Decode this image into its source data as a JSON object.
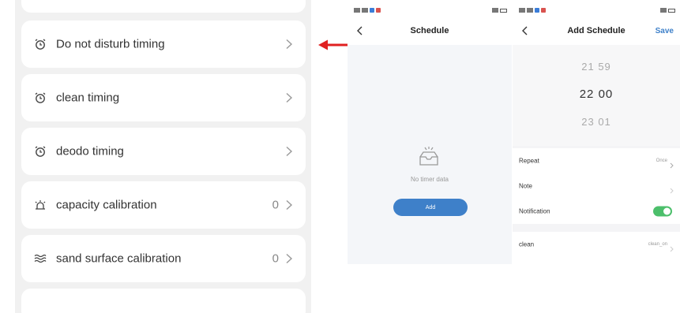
{
  "left": {
    "items": [
      {
        "label": "Do not disturb timing",
        "icon": "alarm-clock-icon",
        "count": ""
      },
      {
        "label": "clean timing",
        "icon": "alarm-clock-icon",
        "count": ""
      },
      {
        "label": "deodo timing",
        "icon": "alarm-clock-icon",
        "count": ""
      },
      {
        "label": "capacity calibration",
        "icon": "bell-icon",
        "count": "0"
      },
      {
        "label": "sand surface calibration",
        "icon": "waves-icon",
        "count": "0"
      }
    ]
  },
  "schedule_screen": {
    "title": "Schedule",
    "empty_text": "No timer data",
    "add_label": "Add"
  },
  "add_schedule_screen": {
    "title": "Add Schedule",
    "save_label": "Save",
    "picker": {
      "above": {
        "hour": "21",
        "minute": "59"
      },
      "selected": {
        "hour": "22",
        "minute": "00"
      },
      "below": {
        "hour": "23",
        "minute": "01"
      }
    },
    "rows": {
      "repeat": {
        "label": "Repeat",
        "value": "Once"
      },
      "note": {
        "label": "Note",
        "value": ""
      },
      "notification": {
        "label": "Notification",
        "enabled": true
      },
      "clean": {
        "label": "clean",
        "value": "clean_on"
      }
    }
  },
  "colors": {
    "accent": "#3e80c9",
    "toggle_on": "#4cbf6b",
    "arrow": "#e02020",
    "panel_bg": "#f1f1f1"
  }
}
